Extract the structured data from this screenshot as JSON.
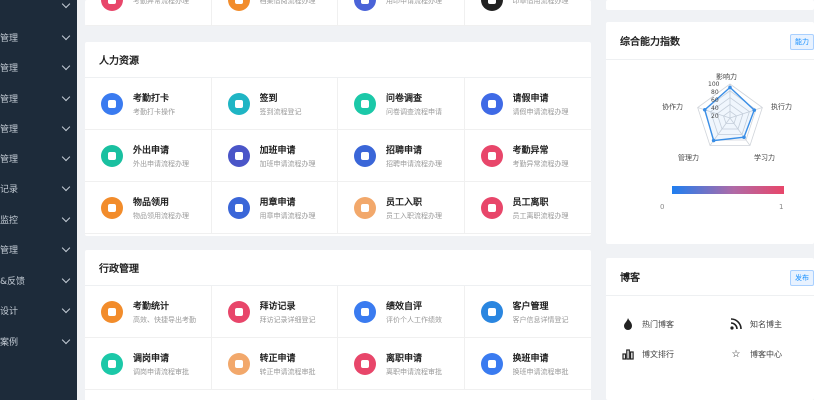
{
  "sidebar": {
    "items": [
      {
        "label": ""
      },
      {
        "label": "管理"
      },
      {
        "label": "管理"
      },
      {
        "label": "管理"
      },
      {
        "label": "管理"
      },
      {
        "label": "管理"
      },
      {
        "label": "记录"
      },
      {
        "label": "监控"
      },
      {
        "label": "管理"
      },
      {
        "label": "&反馈"
      },
      {
        "label": "设计"
      },
      {
        "label": "案例"
      }
    ]
  },
  "top_row": {
    "items": [
      {
        "subtitle": "考勤异常流程办理",
        "color": "#e8466a"
      },
      {
        "subtitle": "档案借阅流程办理",
        "color": "#f28c2b"
      },
      {
        "subtitle": "用印申请流程办理",
        "color": "#4a63d8"
      },
      {
        "subtitle": "印章借用流程办理",
        "color": "#222222"
      }
    ]
  },
  "hr": {
    "title": "人力资源",
    "items": [
      {
        "title": "考勤打卡",
        "subtitle": "考勤打卡操作",
        "color": "#3a7bf0",
        "icon": "location-pin-icon"
      },
      {
        "title": "签到",
        "subtitle": "签到流程登记",
        "color": "#1fb5c4",
        "icon": "location-pin-icon"
      },
      {
        "title": "问卷调查",
        "subtitle": "问卷调查流程申请",
        "color": "#1bc8a8",
        "icon": "survey-icon"
      },
      {
        "title": "请假申请",
        "subtitle": "请假申请流程办理",
        "color": "#3f6ae6",
        "icon": "clock-icon"
      },
      {
        "title": "外出申请",
        "subtitle": "外出申请流程办理",
        "color": "#19c0a0",
        "icon": "location-pin-icon"
      },
      {
        "title": "加班申请",
        "subtitle": "加班申请流程办理",
        "color": "#4a55c8",
        "icon": "lamp-icon"
      },
      {
        "title": "招聘申请",
        "subtitle": "招聘申请流程办理",
        "color": "#3a66d8",
        "icon": "user-icon"
      },
      {
        "title": "考勤异常",
        "subtitle": "考勤异常流程办理",
        "color": "#e8466a",
        "icon": "user-icon"
      },
      {
        "title": "物品领用",
        "subtitle": "物品领用流程办理",
        "color": "#f28c2b",
        "icon": "box-icon"
      },
      {
        "title": "用章申请",
        "subtitle": "用章申请流程办理",
        "color": "#3a66d8",
        "icon": "user-icon"
      },
      {
        "title": "员工入职",
        "subtitle": "员工入职流程办理",
        "color": "#f2a86b",
        "icon": "user-icon"
      },
      {
        "title": "员工离职",
        "subtitle": "员工离职流程办理",
        "color": "#e8466a",
        "icon": "user-icon"
      }
    ]
  },
  "admin": {
    "title": "行政管理",
    "items": [
      {
        "title": "考勤统计",
        "subtitle": "高效、快捷导出考勤",
        "color": "#f28c2b",
        "icon": "bar-chart-icon"
      },
      {
        "title": "拜访记录",
        "subtitle": "拜访记录详细登记",
        "color": "#e8466a",
        "icon": "people-icon"
      },
      {
        "title": "绩效自评",
        "subtitle": "评价个人工作绩效",
        "color": "#3a7bf0",
        "icon": "grid-icon"
      },
      {
        "title": "客户管理",
        "subtitle": "客户信息详情登记",
        "color": "#2a86e0",
        "icon": "chat-icon"
      },
      {
        "title": "调岗申请",
        "subtitle": "调岗申请流程审批",
        "color": "#1bc8a8",
        "icon": "transfer-icon"
      },
      {
        "title": "转正申请",
        "subtitle": "转正申请流程审批",
        "color": "#f2a86b",
        "icon": "user-icon"
      },
      {
        "title": "离职申请",
        "subtitle": "离职申请流程审批",
        "color": "#e8466a",
        "icon": "user-icon"
      },
      {
        "title": "换班申请",
        "subtitle": "换班申请流程审批",
        "color": "#3a7bf0",
        "icon": "alarm-icon"
      }
    ]
  },
  "ability": {
    "title": "综合能力指数",
    "tag": "能力",
    "radar_labels": [
      "影响力",
      "执行力",
      "学习力",
      "管理力",
      "协作力"
    ],
    "ticks": [
      "100",
      "80",
      "60",
      "40",
      "20"
    ],
    "values": [
      90,
      75,
      70,
      82,
      78
    ],
    "range_min": "0",
    "range_max": "1",
    "accent": "#3a8ee6"
  },
  "blog": {
    "title": "博客",
    "tag": "发布",
    "links": [
      {
        "label": "热门博客",
        "icon": "flame-icon"
      },
      {
        "label": "知名博主",
        "icon": "rss-icon"
      },
      {
        "label": "博文排行",
        "icon": "bar-chart-icon"
      },
      {
        "label": "博客中心",
        "icon": "star-icon"
      }
    ]
  }
}
